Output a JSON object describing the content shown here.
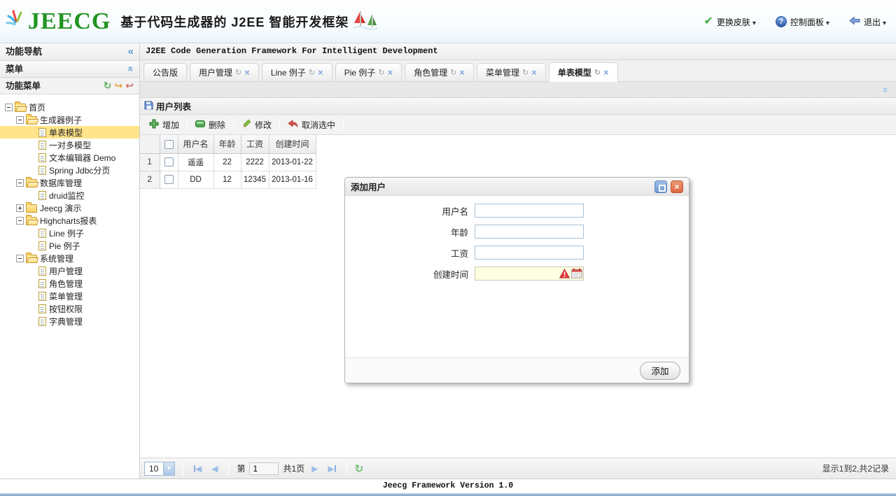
{
  "header": {
    "logo_text": "JEECG",
    "title": "基于代码生成器的 J2EE 智能开发框架",
    "menu": [
      {
        "label": "更换皮肤",
        "icon": "skin-check-icon"
      },
      {
        "label": "控制面板",
        "icon": "question-icon"
      },
      {
        "label": "退出",
        "icon": "logout-arrow-icon"
      }
    ]
  },
  "sidebar": {
    "nav_title": "功能导航",
    "accordion_title": "菜单",
    "panel_title": "功能菜单",
    "panel_icons": [
      "refresh-icon",
      "redo-icon",
      "undo-icon"
    ],
    "tree": [
      {
        "label": "首页",
        "level": 0,
        "icon": "folder-open-icon",
        "expander": "minus",
        "selected": false
      },
      {
        "label": "生成器例子",
        "level": 1,
        "icon": "folder-open-icon",
        "expander": "minus",
        "selected": false
      },
      {
        "label": "单表模型",
        "level": 2,
        "icon": "document-icon",
        "expander": "none",
        "selected": true
      },
      {
        "label": "一对多模型",
        "level": 2,
        "icon": "document-icon",
        "expander": "none",
        "selected": false
      },
      {
        "label": "文本编辑器 Demo",
        "level": 2,
        "icon": "document-icon",
        "expander": "none",
        "selected": false
      },
      {
        "label": "Spring Jdbc分页",
        "level": 2,
        "icon": "document-icon",
        "expander": "none",
        "selected": false
      },
      {
        "label": "数据库管理",
        "level": 1,
        "icon": "folder-open-icon",
        "expander": "minus",
        "selected": false
      },
      {
        "label": "druid监控",
        "level": 2,
        "icon": "document-icon",
        "expander": "none",
        "selected": false
      },
      {
        "label": "Jeecg 演示",
        "level": 1,
        "icon": "folder-closed-icon",
        "expander": "plus",
        "selected": false
      },
      {
        "label": "Highcharts报表",
        "level": 1,
        "icon": "folder-open-icon",
        "expander": "minus",
        "selected": false
      },
      {
        "label": "Line 例子",
        "level": 2,
        "icon": "document-icon",
        "expander": "none",
        "selected": false
      },
      {
        "label": "Pie 例子",
        "level": 2,
        "icon": "document-icon",
        "expander": "none",
        "selected": false
      },
      {
        "label": "系统管理",
        "level": 1,
        "icon": "folder-open-icon",
        "expander": "minus",
        "selected": false
      },
      {
        "label": "用户管理",
        "level": 2,
        "icon": "document-icon",
        "expander": "none",
        "selected": false
      },
      {
        "label": "角色管理",
        "level": 2,
        "icon": "document-icon",
        "expander": "none",
        "selected": false
      },
      {
        "label": "菜单管理",
        "level": 2,
        "icon": "document-icon",
        "expander": "none",
        "selected": false
      },
      {
        "label": "按钮权限",
        "level": 2,
        "icon": "document-icon",
        "expander": "none",
        "selected": false
      },
      {
        "label": "字典管理",
        "level": 2,
        "icon": "document-icon",
        "expander": "none",
        "selected": false
      }
    ]
  },
  "main": {
    "title": "J2EE Code Generation Framework For Intelligent Development",
    "tabs": [
      {
        "label": "公告版",
        "closable": false,
        "active": false
      },
      {
        "label": "用户管理",
        "closable": true,
        "active": false
      },
      {
        "label": "Line 例子",
        "closable": true,
        "active": false
      },
      {
        "label": "Pie 例子",
        "closable": true,
        "active": false
      },
      {
        "label": "角色管理",
        "closable": true,
        "active": false
      },
      {
        "label": "菜单管理",
        "closable": true,
        "active": false
      },
      {
        "label": "单表模型",
        "closable": true,
        "active": true
      }
    ],
    "panel_title": "用户列表",
    "panel_icon": "save-disk-icon",
    "toolbar": [
      {
        "label": "增加",
        "icon": "add-icon"
      },
      {
        "label": "删除",
        "icon": "delete-icon"
      },
      {
        "label": "修改",
        "icon": "edit-icon"
      },
      {
        "label": "取消选中",
        "icon": "cancel-select-icon"
      }
    ],
    "table": {
      "columns": [
        "用户名",
        "年龄",
        "工资",
        "创建时间"
      ],
      "rows": [
        {
          "num": "1",
          "cells": [
            "遥遥",
            "22",
            "2222",
            "2013-01-22"
          ]
        },
        {
          "num": "2",
          "cells": [
            "DD",
            "12",
            "12345",
            "2013-01-16"
          ]
        }
      ]
    },
    "pagination": {
      "page_size": "10",
      "jump_prefix": "第",
      "page_value": "1",
      "total_pages_label": "共1页",
      "summary": "显示1到2,共2记录"
    }
  },
  "dialog": {
    "title": "添加用户",
    "fields": [
      {
        "label": "用户名"
      },
      {
        "label": "年龄"
      },
      {
        "label": "工资"
      },
      {
        "label": "创建时间"
      }
    ],
    "submit_label": "添加"
  },
  "footer": {
    "text": "Jeecg Framework Version 1.0"
  },
  "colors": {
    "logo_green": "#219421",
    "selected_tree_yellow": "#ffe48b",
    "tab_close_blue": "#7fa7dc",
    "date_field_bg": "#ffffe1"
  }
}
